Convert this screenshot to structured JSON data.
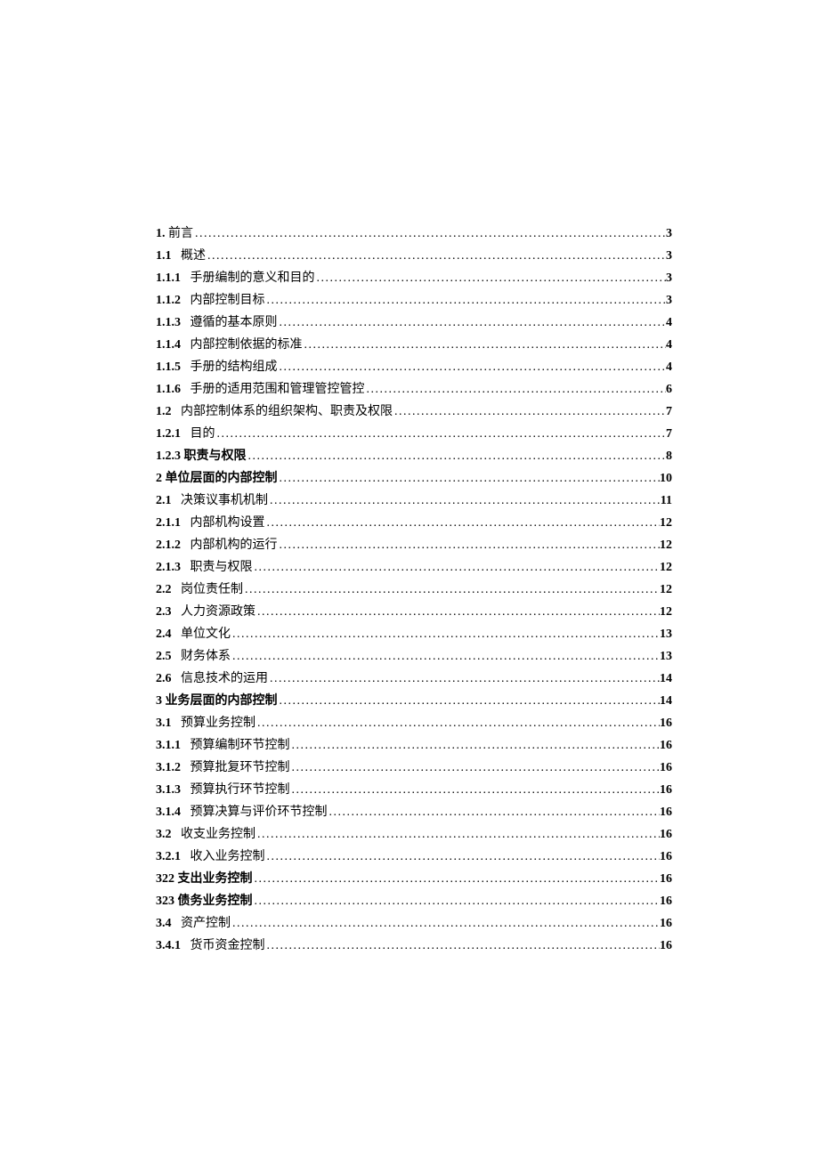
{
  "toc": [
    {
      "num": "1.",
      "title": "前言",
      "page": "3",
      "gap": " ",
      "boldTitle": false
    },
    {
      "num": "1.1",
      "title": "概述",
      "page": "3",
      "gap": "   ",
      "boldTitle": false
    },
    {
      "num": "1.1.1",
      "title": "手册编制的意义和目的",
      "page": "3",
      "gap": "   ",
      "boldTitle": false
    },
    {
      "num": "1.1.2",
      "title": "内部控制目标",
      "page": "3",
      "gap": "   ",
      "boldTitle": false
    },
    {
      "num": "1.1.3",
      "title": "遵循的基本原则",
      "page": "4",
      "gap": "   ",
      "boldTitle": false
    },
    {
      "num": "1.1.4",
      "title": "内部控制依据的标准",
      "page": "4",
      "gap": "   ",
      "boldTitle": false
    },
    {
      "num": "1.1.5",
      "title": "手册的结构组成",
      "page": "4",
      "gap": "   ",
      "boldTitle": false
    },
    {
      "num": "1.1.6",
      "title": "手册的适用范围和管理管控管控",
      "page": "6",
      "gap": "   ",
      "boldTitle": false
    },
    {
      "num": "1.2",
      "title": "内部控制体系的组织架构、职责及权限",
      "page": "7",
      "gap": "   ",
      "boldTitle": false
    },
    {
      "num": "1.2.1",
      "title": "目的",
      "page": "7",
      "gap": "   ",
      "boldTitle": false
    },
    {
      "num": "1.2.3",
      "title": "职责与权限",
      "page": "8",
      "gap": " ",
      "boldTitle": true
    },
    {
      "num": "2",
      "title": "单位层面的内部控制",
      "page": "10",
      "gap": " ",
      "boldTitle": true
    },
    {
      "num": "2.1",
      "title": "决策议事机机制",
      "page": "11",
      "gap": "   ",
      "boldTitle": false
    },
    {
      "num": "2.1.1",
      "title": "内部机构设置",
      "page": "12",
      "gap": "   ",
      "boldTitle": false
    },
    {
      "num": "2.1.2",
      "title": "内部机构的运行",
      "page": "12",
      "gap": "   ",
      "boldTitle": false
    },
    {
      "num": "2.1.3",
      "title": "职责与权限",
      "page": "12",
      "gap": "   ",
      "boldTitle": false
    },
    {
      "num": "2.2",
      "title": "岗位责任制",
      "page": "12",
      "gap": "   ",
      "boldTitle": false
    },
    {
      "num": "2.3",
      "title": "人力资源政策",
      "page": "12",
      "gap": "   ",
      "boldTitle": false
    },
    {
      "num": "2.4",
      "title": "单位文化",
      "page": "13",
      "gap": "   ",
      "boldTitle": false
    },
    {
      "num": "2.5",
      "title": "财务体系",
      "page": "13",
      "gap": "   ",
      "boldTitle": false
    },
    {
      "num": "2.6",
      "title": "信息技术的运用",
      "page": "14",
      "gap": "   ",
      "boldTitle": false
    },
    {
      "num": "3",
      "title": "业务层面的内部控制",
      "page": "14",
      "gap": " ",
      "boldTitle": true
    },
    {
      "num": "3.1",
      "title": "预算业务控制",
      "page": "16",
      "gap": "   ",
      "boldTitle": false
    },
    {
      "num": "3.1.1",
      "title": "预算编制环节控制",
      "page": "16",
      "gap": "   ",
      "boldTitle": false
    },
    {
      "num": "3.1.2",
      "title": "预算批复环节控制",
      "page": "16",
      "gap": "   ",
      "boldTitle": false
    },
    {
      "num": "3.1.3",
      "title": "预算执行环节控制",
      "page": "16",
      "gap": "   ",
      "boldTitle": false
    },
    {
      "num": "3.1.4",
      "title": "预算决算与评价环节控制",
      "page": "16",
      "gap": "   ",
      "boldTitle": false
    },
    {
      "num": "3.2",
      "title": "收支业务控制",
      "page": "16",
      "gap": "   ",
      "boldTitle": false
    },
    {
      "num": "3.2.1",
      "title": "收入业务控制",
      "page": "16",
      "gap": "   ",
      "boldTitle": false
    },
    {
      "num": "322",
      "title": "支出业务控制",
      "page": "16",
      "gap": " ",
      "boldTitle": true
    },
    {
      "num": "323",
      "title": "债务业务控制",
      "page": "16",
      "gap": " ",
      "boldTitle": true
    },
    {
      "num": "3.4",
      "title": "资产控制",
      "page": "16",
      "gap": "   ",
      "boldTitle": false
    },
    {
      "num": "3.4.1",
      "title": "货币资金控制",
      "page": "16",
      "gap": "   ",
      "boldTitle": false
    }
  ]
}
